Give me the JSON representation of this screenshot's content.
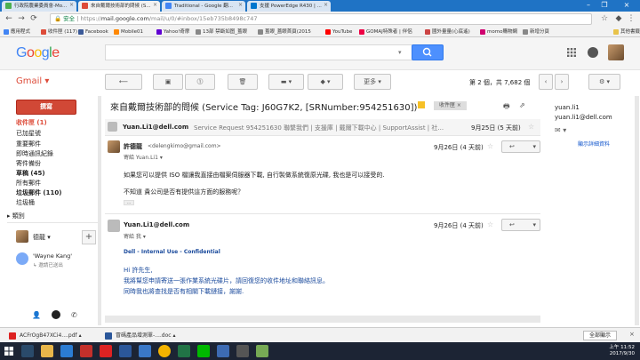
{
  "tabs": [
    {
      "label": "行政院農業委員會-Mo..."
    },
    {
      "label": "來自戴爾技術部的問候 (S..."
    },
    {
      "label": "Traditional - Google 翻..."
    },
    {
      "label": "支援 PowerEdge R430 | ..."
    }
  ],
  "address": {
    "secure": "安全",
    "prefix": "https://",
    "host": "mail.google.com",
    "path": "/mail/u/0/#inbox/15eb735b8498c747"
  },
  "bookmarks": [
    {
      "label": "應用程式",
      "color": "#4285f4"
    },
    {
      "label": "收件匣 (117)",
      "color": "#dd4b39"
    },
    {
      "label": "Facebook",
      "color": "#3b5998"
    },
    {
      "label": "Mobile01",
      "color": "#ff8800"
    },
    {
      "label": "Yahoo!奇摩",
      "color": "#6001d2"
    },
    {
      "label": "13部 禁斷如图_蓋眼",
      "color": "#888"
    },
    {
      "label": "蓋眼_蓋眼首頁(2015",
      "color": "#888"
    },
    {
      "label": "YouTube",
      "color": "#ff0000"
    },
    {
      "label": "GOMAJ特殊者 | 伴侶",
      "color": "#e04"
    },
    {
      "label": "國外量量(心底遙)",
      "color": "#c44"
    },
    {
      "label": "momo購物網",
      "color": "#d0006f"
    },
    {
      "label": "新增分頁",
      "color": "#888"
    },
    {
      "label": "其他書籤",
      "color": "#e8c34a"
    }
  ],
  "gmail": {
    "label": "Gmail",
    "compose": "撰寫",
    "more_btn": "更多",
    "pagination": "第 2 個，共 7,682 個",
    "nav": [
      {
        "label": "收件匣 (1)",
        "style": "active"
      },
      {
        "label": "已加星號",
        "style": ""
      },
      {
        "label": "重要郵件",
        "style": ""
      },
      {
        "label": "即時通訊紀錄",
        "style": ""
      },
      {
        "label": "寄件備份",
        "style": ""
      },
      {
        "label": "草稿 (45)",
        "style": "bold"
      },
      {
        "label": "所有郵件",
        "style": ""
      },
      {
        "label": "垃圾郵件 (110)",
        "style": "bold"
      },
      {
        "label": "垃圾桶",
        "style": ""
      },
      {
        "label": "類別",
        "style": ""
      }
    ],
    "hangouts_user": "德龍",
    "contact": {
      "name": "'Wayne Kang'",
      "status": "邀請已送出"
    }
  },
  "thread": {
    "subject": "來自戴爾技術部的問候 (Service Tag: J60G7K2, [SRNumber:954251630])",
    "inbox_chip": "收件匣",
    "collapsed": {
      "from": "Yuan.Li1@dell.com",
      "snippet": "Service Request 954251630 聯繫我們 | 支援庫 | 戴爾下載中心 | SupportAssist | 社...",
      "date": "9月25日 (5 天前)"
    },
    "msg1": {
      "from": "許德龍",
      "email": "<delengkimo@gmail.com>",
      "to": "寄給 Yuan.Li1",
      "date": "9月26日 (4 天前)",
      "line1": "如果您可以提供 ISO 檔讓我直接由檔案伺服器下載, 自行製做系統復原光碟, 我也是可以接受的.",
      "line2": "不知道 貴公司是否有提供這方面的服務呢？",
      "ellipsis": "..."
    },
    "msg2": {
      "from": "Yuan.Li1@dell.com",
      "to": "寄給 我",
      "date": "9月26日 (4 天前)",
      "classification": "Dell - Internal Use - Confidential",
      "greeting": "Hi 許先生,",
      "line1": "我將幫您申請寄送一張作業系統光碟片，請回復您的收件地址和聯絡訊息。",
      "line2": "同時我也將查找是否有相關下載鏈接，謝謝."
    }
  },
  "rightpanel": {
    "name": "yuan.li1",
    "email": "yuan.li1@dell.com",
    "link": "顯示詳細資料"
  },
  "downloads": [
    {
      "label": "ACFrOgB47XCi4....pdf",
      "color": "#d22"
    },
    {
      "label": "冒碼產品增測單-....doc",
      "color": "#2b579a"
    }
  ],
  "downloads_all": "全部顯示",
  "clock": {
    "time": "上午 11:52",
    "date": "2017/9/30"
  }
}
